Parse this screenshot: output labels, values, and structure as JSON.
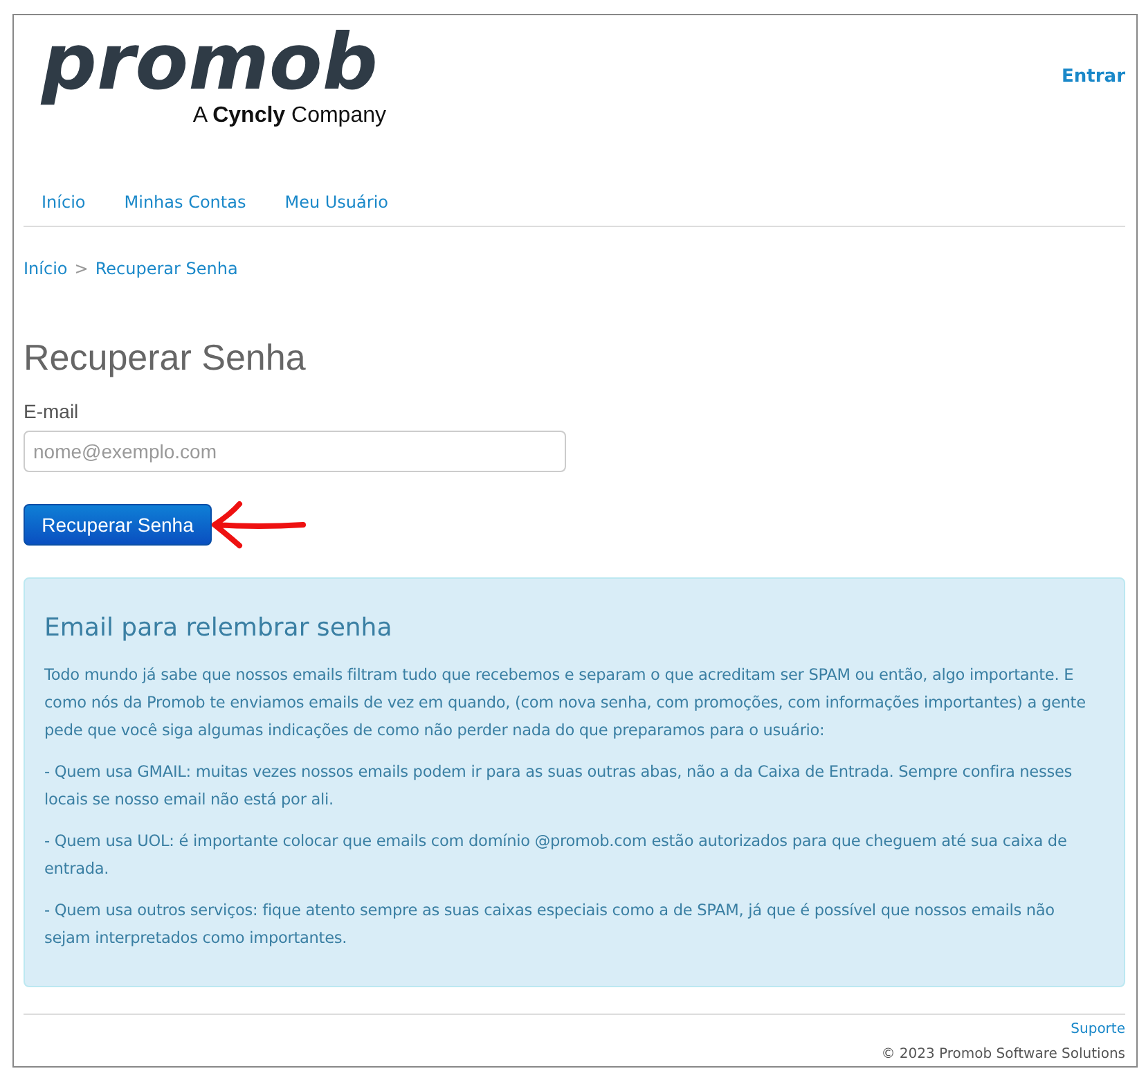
{
  "logo": {
    "wordmark": "promob",
    "tagline_prefix": "A",
    "tagline_brand": "Cyncly",
    "tagline_suffix": "Company"
  },
  "header": {
    "login_link": "Entrar"
  },
  "nav": [
    "Início",
    "Minhas Contas",
    "Meu Usuário"
  ],
  "breadcrumb": {
    "items": [
      "Início",
      "Recuperar Senha"
    ],
    "separator": ">"
  },
  "form": {
    "title": "Recuperar Senha",
    "email_label": "E-mail",
    "email_placeholder": "nome@exemplo.com",
    "submit": "Recuperar Senha"
  },
  "info": {
    "title": "Email para relembrar senha",
    "paragraphs": [
      "Todo mundo já sabe que nossos emails filtram tudo que recebemos e separam o que acreditam ser SPAM ou então, algo importante. E como nós da Promob te enviamos emails de vez em quando, (com nova senha, com promoções, com informações importantes) a gente pede que você siga algumas indicações de como não perder nada do que preparamos para o usuário:",
      "- Quem usa GMAIL: muitas vezes nossos emails podem ir para as suas outras abas, não a da Caixa de Entrada. Sempre confira nesses locais se nosso email não está por ali.",
      "- Quem usa UOL: é importante colocar que emails com domínio @promob.com estão autorizados para que cheguem até sua caixa de entrada.",
      "- Quem usa outros serviços: fique atento sempre as suas caixas especiais como a de SPAM, já que é possível que nossos emails não sejam interpretados como importantes."
    ]
  },
  "footer": {
    "support_link": "Suporte",
    "copyright": "© 2023 Promob Software Solutions"
  }
}
